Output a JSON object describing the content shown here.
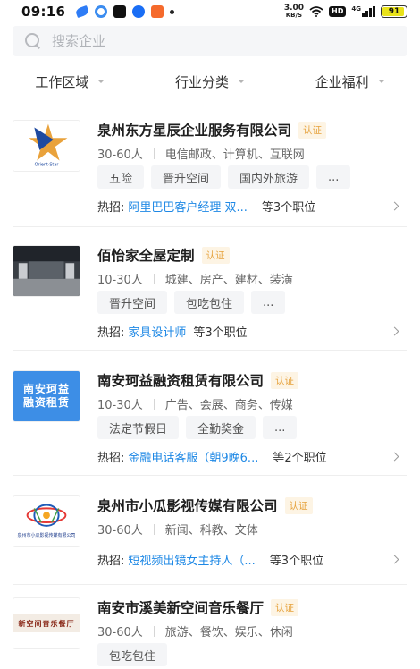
{
  "status_bar": {
    "time": "09:16",
    "net_speed_value": "3.00",
    "net_speed_unit": "KB/S",
    "hd_label": "HD",
    "signal_label": "4G",
    "battery_level": "91"
  },
  "search": {
    "placeholder": "搜索企业",
    "value": ""
  },
  "filters": [
    {
      "label": "工作区域"
    },
    {
      "label": "行业分类"
    },
    {
      "label": "企业福利"
    }
  ],
  "companies": [
    {
      "name": "泉州东方星辰企业服务有限公司",
      "badge": "认证",
      "size": "30-60人",
      "industry": "电信邮政、计算机、互联网",
      "tags": [
        "五险",
        "晋升空间",
        "国内外旅游",
        "..."
      ],
      "hot_label": "热招:",
      "hot_job": "阿里巴巴客户经理   双...",
      "job_count": "等3个职位",
      "logo": "star-logo"
    },
    {
      "name": "佰怡家全屋定制",
      "badge": "认证",
      "size": "10-30人",
      "industry": "城建、房产、建材、装潢",
      "tags": [
        "晋升空间",
        "包吃包住",
        "..."
      ],
      "hot_label": "热招:",
      "hot_job": "家具设计师",
      "job_count": "等3个职位",
      "logo": "showroom-photo"
    },
    {
      "name": "南安珂益融资租赁有限公司",
      "badge": "认证",
      "size": "10-30人",
      "industry": "广告、会展、商务、传媒",
      "tags": [
        "法定节假日",
        "全勤奖金",
        "..."
      ],
      "hot_label": "热招:",
      "hot_job": "金融电话客服（朝9晚6...",
      "job_count": "等2个职位",
      "logo": "text-logo",
      "logo_text": "南安珂益 融资租赁"
    },
    {
      "name": "泉州市小瓜影视传媒有限公司",
      "badge": "认证",
      "size": "30-60人",
      "industry": "新闻、科教、文体",
      "tags": [],
      "hot_label": "热招:",
      "hot_job": "短视频出镜女主持人（...",
      "job_count": "等3个职位",
      "logo": "media-logo",
      "logo_text": "泉州市小瓜影视传媒有限公司"
    },
    {
      "name": "南安市溪美新空间音乐餐厅",
      "badge": "认证",
      "size": "30-60人",
      "industry": "旅游、餐饮、娱乐、休闲",
      "tags": [
        "包吃包住"
      ],
      "logo": "restaurant-sign",
      "logo_text": "新空间音乐餐厅"
    }
  ],
  "colors": {
    "link_blue": "#1e88e5",
    "badge_orange": "#e6a23c",
    "badge_bg": "#fdf4e4"
  }
}
